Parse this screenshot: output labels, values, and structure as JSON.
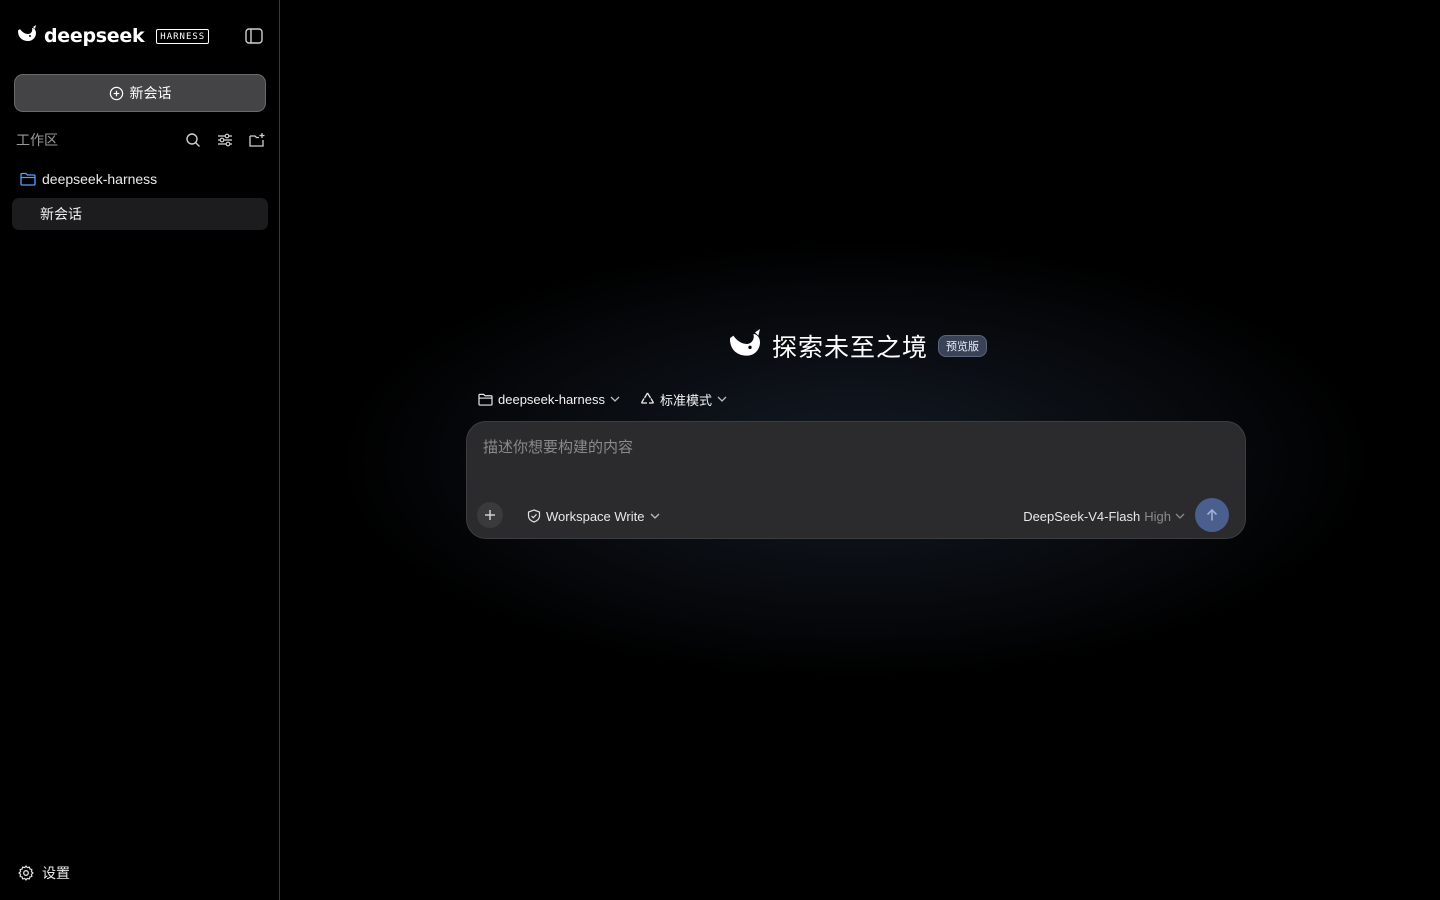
{
  "sidebar": {
    "brand_name": "deepseek",
    "brand_tag": "HARNESS",
    "toggle_icon": "sidebar-toggle-icon",
    "new_chat_label": "新会话",
    "workspace_label": "工作区",
    "workspace_tools": [
      "search-icon",
      "filter-icon",
      "new-folder-icon"
    ],
    "project_name": "deepseek-harness",
    "chats": [
      {
        "label": "新会话",
        "active": true
      }
    ],
    "settings_label": "设置"
  },
  "main": {
    "hero_title": "探索未至之境",
    "hero_badge": "预览版",
    "project_selector": "deepseek-harness",
    "mode_selector": "标准模式",
    "composer": {
      "placeholder": "描述你想要构建的内容",
      "value": "",
      "permission": "Workspace Write",
      "model": "DeepSeek-V4-Flash",
      "level": "High"
    }
  },
  "colors": {
    "accent": "#4a5f8e",
    "folder_blue": "#5b9cff",
    "badge_bg": "#3a4256"
  }
}
